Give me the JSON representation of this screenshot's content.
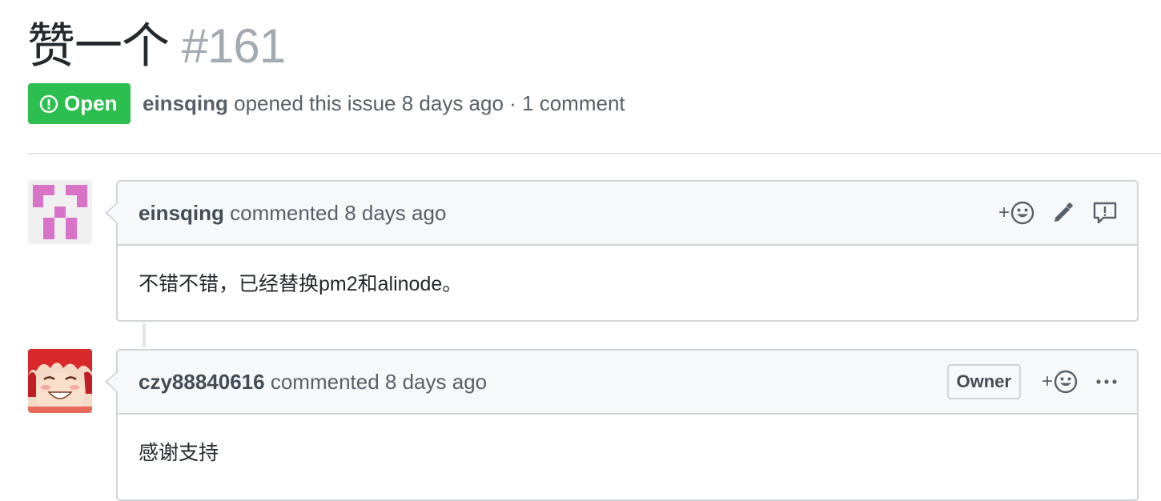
{
  "issue": {
    "title": "赞一个",
    "number": "#161",
    "state_label": "Open",
    "author": "einsqing",
    "meta_suffix": "opened this issue 8 days ago · 1 comment"
  },
  "comments": [
    {
      "author": "einsqing",
      "action": "commented 8 days ago",
      "body": "不错不错，已经替换pm2和alinode。",
      "badge": "",
      "icons": [
        "add-reaction-icon",
        "pencil-icon",
        "report-icon"
      ]
    },
    {
      "author": "czy88840616",
      "action": "commented 8 days ago",
      "body": "感谢支持",
      "badge": "Owner",
      "icons": [
        "add-reaction-icon",
        "more-icon"
      ]
    }
  ],
  "colors": {
    "open_green": "#2cbe4e",
    "header_bg": "#f6f8fa",
    "border": "#d1d5da",
    "identicon_pink": "#d873c8"
  }
}
